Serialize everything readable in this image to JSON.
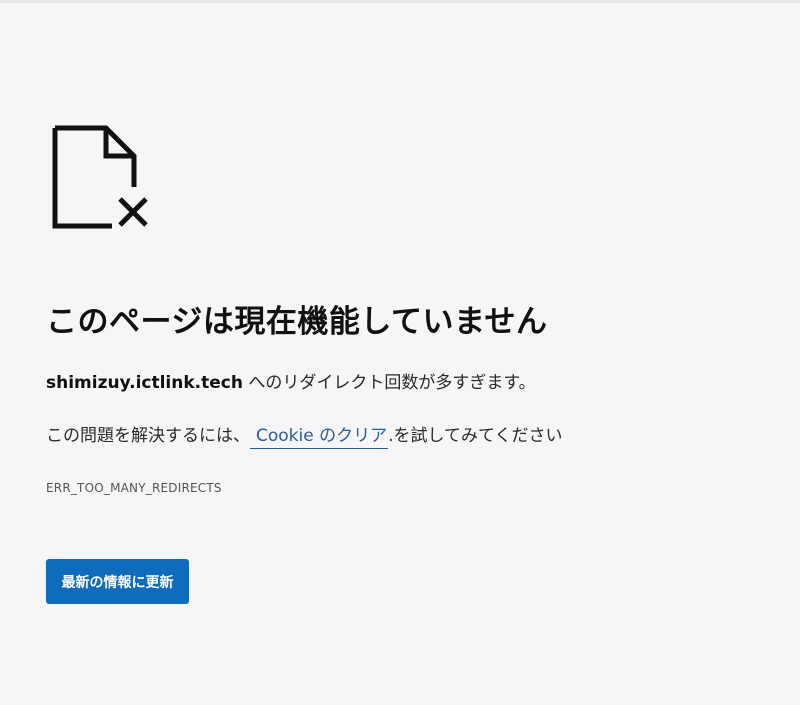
{
  "icon": {
    "name": "broken-file-icon"
  },
  "title": "このページは現在機能していません",
  "message": {
    "domain": "shimizuy.ictlink.tech",
    "suffix": " へのリダイレクト回数が多すぎます。"
  },
  "suggestion": {
    "prefix": "この問題を解決するには、",
    "link_label": "Cookie のクリア",
    "suffix": ".を試してみてください"
  },
  "error_code": "ERR_TOO_MANY_REDIRECTS",
  "refresh_button": {
    "label": "最新の情報に更新",
    "color": "#0f6cbd"
  },
  "colors": {
    "background": "#f6f6f8",
    "link": "#2b5c95"
  }
}
